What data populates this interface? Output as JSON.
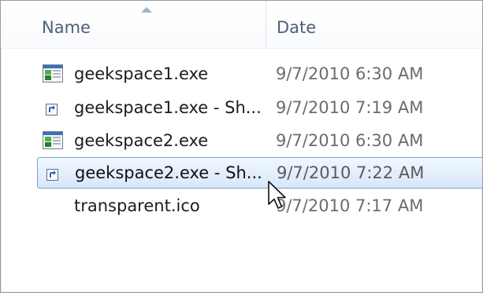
{
  "columns": {
    "name_label": "Name",
    "date_label": "Date"
  },
  "files": [
    {
      "name": "geekspace1.exe",
      "date": "9/7/2010 6:30 AM",
      "icon": "exe-app-icon",
      "selected": false
    },
    {
      "name": "geekspace1.exe - Sh...",
      "date": "9/7/2010 7:19 AM",
      "icon": "shortcut-icon",
      "selected": false
    },
    {
      "name": "geekspace2.exe",
      "date": "9/7/2010 6:30 AM",
      "icon": "exe-app-icon",
      "selected": false
    },
    {
      "name": "geekspace2.exe - Sh...",
      "date": "9/7/2010 7:22 AM",
      "icon": "shortcut-icon",
      "selected": true
    },
    {
      "name": "transparent.ico",
      "date": "9/7/2010 7:17 AM",
      "icon": "none",
      "selected": false
    }
  ],
  "colors": {
    "header_text": "#4c607a",
    "selection_border": "#7da2ce",
    "selection_fill": "#d7e7fa"
  }
}
